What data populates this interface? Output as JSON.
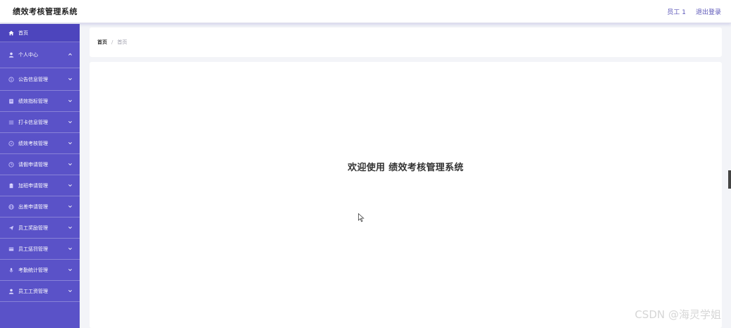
{
  "header": {
    "title": "绩效考核管理系统",
    "user": "员工 1",
    "logout": "退出登录"
  },
  "sidebar": {
    "items": [
      {
        "label": "首页",
        "icon": "home-icon"
      },
      {
        "label": "个人中心",
        "icon": "user-icon",
        "expanded": true
      },
      {
        "label": "公告信息管理",
        "icon": "info-icon"
      },
      {
        "label": "绩效指标管理",
        "icon": "document-icon"
      },
      {
        "label": "打卡信息管理",
        "icon": "list-icon"
      },
      {
        "label": "绩效考核管理",
        "icon": "compass-icon"
      },
      {
        "label": "请假申请管理",
        "icon": "clock-icon"
      },
      {
        "label": "加班申请管理",
        "icon": "clipboard-icon"
      },
      {
        "label": "出差申请管理",
        "icon": "globe-icon"
      },
      {
        "label": "员工奖励管理",
        "icon": "send-icon"
      },
      {
        "label": "员工惩罚管理",
        "icon": "card-icon"
      },
      {
        "label": "考勤统计管理",
        "icon": "mic-icon"
      },
      {
        "label": "员工工资管理",
        "icon": "person-icon"
      }
    ]
  },
  "breadcrumb": {
    "home": "首页",
    "separator": "/",
    "current": "首页"
  },
  "main": {
    "welcome": "欢迎使用 绩效考核管理系统"
  },
  "watermark": "CSDN @海灵学姐",
  "colors": {
    "sidebar_bg": "#5a52c8",
    "accent": "#5b56b8",
    "page_bg": "#f3f4f8"
  }
}
